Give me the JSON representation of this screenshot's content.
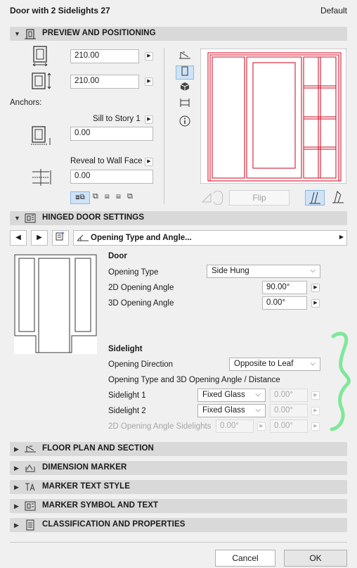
{
  "window": {
    "title": "Door with 2 Sidelights 27",
    "preset": "Default"
  },
  "sections": {
    "preview": "PREVIEW AND POSITIONING",
    "hinged": "HINGED DOOR SETTINGS",
    "floor_plan": "FLOOR PLAN AND SECTION",
    "dimension": "DIMENSION MARKER",
    "marker_text": "MARKER TEXT STYLE",
    "marker_symbol": "MARKER SYMBOL AND TEXT",
    "classification": "CLASSIFICATION AND PROPERTIES"
  },
  "positioning": {
    "width": "210.00",
    "height": "210.00",
    "anchors_label": "Anchors:",
    "sill_label": "Sill to Story 1",
    "sill_value": "0.00",
    "reveal_label": "Reveal to Wall Face",
    "reveal_value": "0.00",
    "flip_label": "Flip"
  },
  "hinged": {
    "page_selector": "Opening Type and Angle...",
    "door_heading": "Door",
    "opening_type_label": "Opening Type",
    "opening_type_value": "Side Hung",
    "angle2d_label": "2D Opening Angle",
    "angle2d_value": "90.00°",
    "angle3d_label": "3D Opening Angle",
    "angle3d_value": "0.00°",
    "sidelight_heading": "Sidelight",
    "direction_label": "Opening Direction",
    "direction_value": "Opposite to Leaf",
    "subheading": "Opening Type and 3D Opening Angle / Distance",
    "sidelight1_label": "Sidelight 1",
    "sidelight1_type": "Fixed Glass",
    "sidelight1_angle": "0.00°",
    "sidelight2_label": "Sidelight 2",
    "sidelight2_type": "Fixed Glass",
    "sidelight2_angle": "0.00°",
    "angle_sidelights_label": "2D Opening Angle Sidelights",
    "angle_sidelights_value1": "0.00°",
    "angle_sidelights_value2": "0.00°"
  },
  "footer": {
    "cancel": "Cancel",
    "ok": "OK"
  },
  "colors": {
    "preview_stroke": "#d0021b",
    "annotation": "#7ee89a",
    "section_bg": "#d9d9d9"
  }
}
